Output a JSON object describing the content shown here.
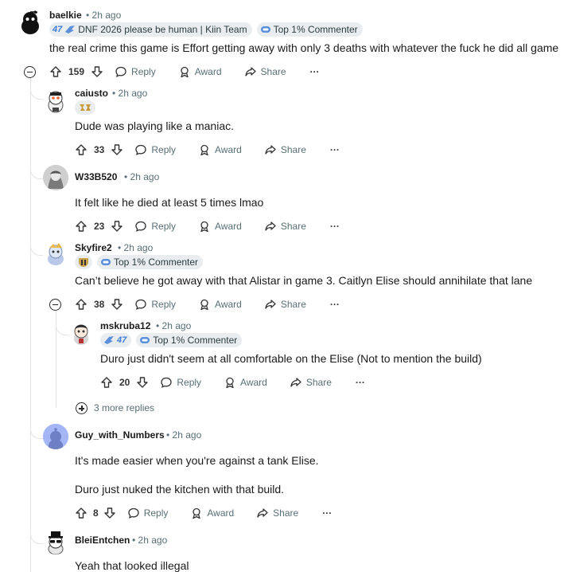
{
  "comments": {
    "c1": {
      "author": "baelkie",
      "time": "2h ago",
      "flair_team": "DNF 2026 please be human | Kiin Team",
      "flair_team_badge": "47",
      "flair_commenter": "Top 1% Commenter",
      "body": "the real crime this game is Effort getting away with only 3 deaths with whatever the fuck he did all game",
      "votes": "159"
    },
    "c2": {
      "author": "caiusto",
      "time": "2h ago",
      "body": "Dude was playing like a maniac.",
      "votes": "33"
    },
    "c3": {
      "author": "W33B520",
      "time": "2h ago",
      "body": "It felt like he died at least 5 times lmao",
      "votes": "23"
    },
    "c4": {
      "author": "Skyfire2",
      "time": "2h ago",
      "flair_commenter": "Top 1% Commenter",
      "body": "Can’t believe he got away with that Alistar in game 3. Caitlyn Elise should annihilate that lane",
      "votes": "38"
    },
    "c5": {
      "author": "mskruba12",
      "time": "2h ago",
      "flair_badge": "47",
      "flair_commenter": "Top 1% Commenter",
      "body": "Duro just didn't seem at all comfortable on the Elise (Not to mention the build)",
      "votes": "20"
    },
    "more_replies": "3 more replies",
    "c6": {
      "author": "Guy_with_Numbers",
      "time": "2h ago",
      "body_1": "It's made easier when you're against a tank Elise.",
      "body_2": "Duro just nuked the kitchen with that build.",
      "votes": "8"
    },
    "c7": {
      "author": "BleiEntchen",
      "time": "2h ago",
      "body": "Yeah that looked illegal"
    }
  },
  "actions": {
    "reply": "Reply",
    "award": "Award",
    "share": "Share",
    "more": "···",
    "separator": "•"
  },
  "colors": {
    "text": "#1a1a1b",
    "meta": "#576f76",
    "flair_bg": "#eaedef",
    "thread_line": "#e2e4e6",
    "badge_blue": "#3b7dd8"
  }
}
